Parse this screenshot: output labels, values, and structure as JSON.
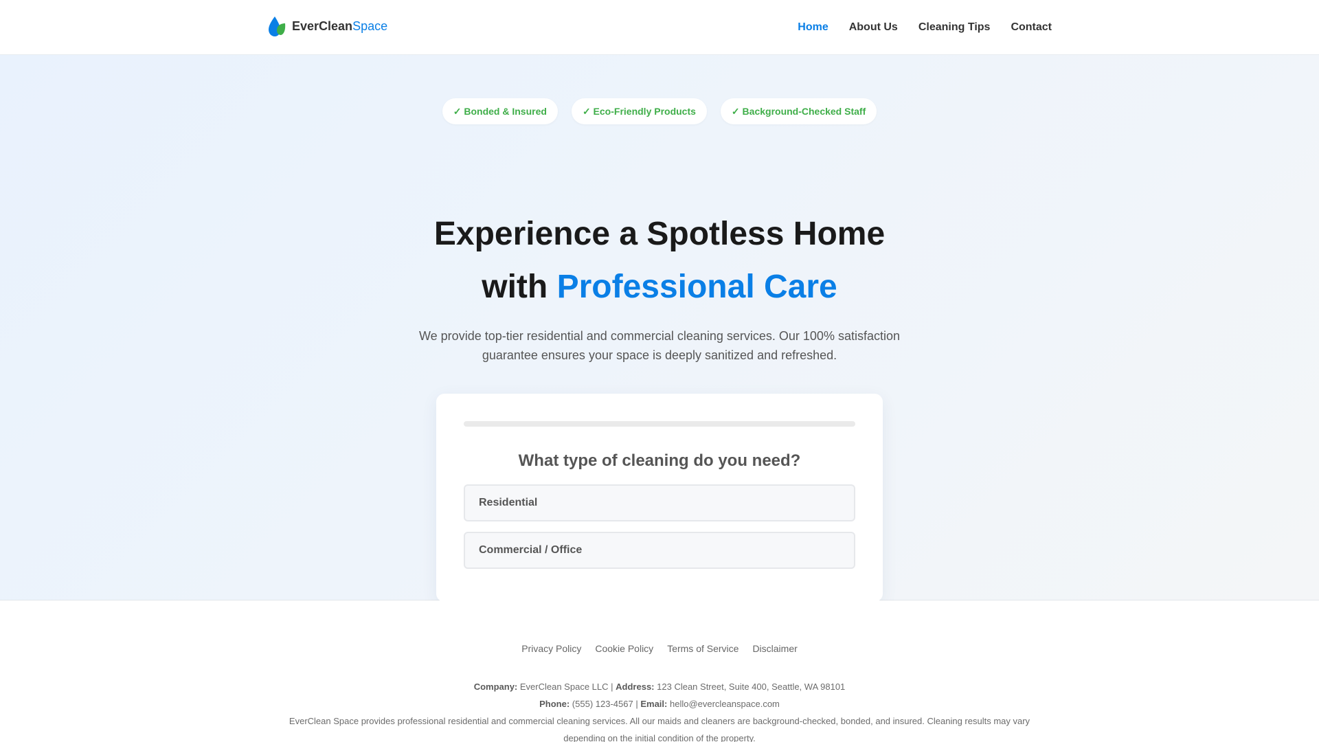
{
  "brand": {
    "name_part1": "EverClean",
    "name_part2": "Space",
    "logo_icon": "leaf-drop-icon",
    "colors": {
      "primary": "#0a7fe6",
      "leaf": "#3fae49"
    }
  },
  "nav": {
    "items": [
      {
        "label": "Home",
        "active": true
      },
      {
        "label": "About Us",
        "active": false
      },
      {
        "label": "Cleaning Tips",
        "active": false
      },
      {
        "label": "Contact",
        "active": false
      }
    ]
  },
  "hero": {
    "badges": [
      "✓ Bonded & Insured",
      "✓ Eco-Friendly Products",
      "✓ Background-Checked Staff"
    ],
    "headline_line1": "Experience a Spotless Home",
    "headline_line2_prefix": "with ",
    "headline_line2_accent": "Professional Care",
    "subtext": "We provide top-tier residential and commercial cleaning services. Our 100% satisfaction guarantee ensures your space is deeply sanitized and refreshed."
  },
  "quiz": {
    "progress_fraction": 0,
    "question": "What type of cleaning do you need?",
    "options": [
      "Residential",
      "Commercial / Office"
    ]
  },
  "footer": {
    "links": [
      "Privacy Policy",
      "Cookie Policy",
      "Terms of Service",
      "Disclaimer"
    ],
    "company_label": "Company:",
    "company_value": "EverClean Space LLC",
    "separator": "|",
    "address_label": "Address:",
    "address_value": "123 Clean Street, Suite 400, Seattle, WA 98101",
    "phone_label": "Phone:",
    "phone_value": "(555) 123-4567",
    "email_label": "Email:",
    "email_value": "hello@evercleanspace.com",
    "disclaimer": "EverClean Space provides professional residential and commercial cleaning services. All our maids and cleaners are background-checked, bonded, and insured. Cleaning results may vary depending on the initial condition of the property."
  }
}
